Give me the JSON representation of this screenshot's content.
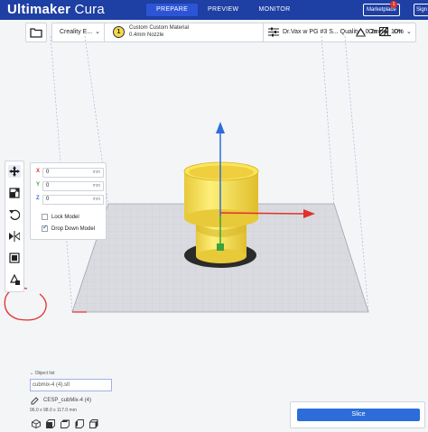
{
  "app": {
    "title_main": "Ultimaker",
    "title_sub": "Cura"
  },
  "stages": [
    {
      "label": "PREPARE",
      "active": true
    },
    {
      "label": "PREVIEW",
      "active": false
    },
    {
      "label": "MONITOR",
      "active": false
    }
  ],
  "header": {
    "marketplace_label": "Marketplace",
    "notification_count": "1",
    "signin_label": "Sign"
  },
  "toolbar": {
    "printer": "Creality E...",
    "extruder_number": "1",
    "material": "Custom Custom Material",
    "nozzle": "0.4mm Nozzle",
    "profile": "Dr.Vax w PG #3 S... Quality - 0.2mm",
    "infill": "10%",
    "support": "On",
    "adhesion": "On"
  },
  "move_panel": {
    "axes": [
      {
        "axis": "X",
        "value": "0",
        "unit": "mm",
        "color": "#e0312c"
      },
      {
        "axis": "Y",
        "value": "0",
        "unit": "mm",
        "color": "#3aa33a"
      },
      {
        "axis": "Z",
        "value": "0",
        "unit": "mm",
        "color": "#2c6ddb"
      }
    ],
    "lock_model_label": "Lock Model",
    "lock_model_checked": false,
    "drop_down_label": "Drop Down Model",
    "drop_down_checked": true
  },
  "object_list": {
    "header": "Object list",
    "selected": "cubmix-4 (4).stl",
    "job_name": "CESP_cubMix-4 (4)",
    "dimensions": "96.0 x 98.0 x 117.0 mm"
  },
  "slice_button_label": "Slice",
  "colors": {
    "header_bg": "#1e3fa3",
    "accent": "#2c6ddb",
    "model_yellow": "#f7e64a",
    "annotation_red": "#e0312c"
  }
}
